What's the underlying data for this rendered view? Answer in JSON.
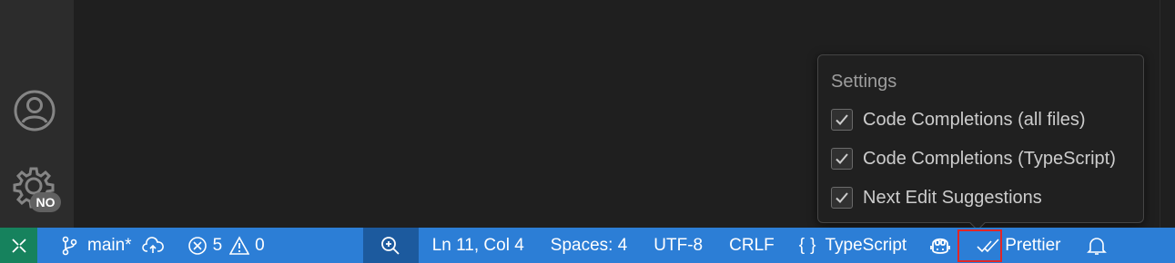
{
  "activity_bar": {
    "icons": [
      "account-icon",
      "manage-gear-icon"
    ],
    "badge": "NO"
  },
  "status_bar": {
    "remote_icon": "remote-icon",
    "branch": "main*",
    "errors": "5",
    "warnings": "0",
    "position": "Ln 11, Col 4",
    "spaces": "Spaces: 4",
    "encoding": "UTF-8",
    "eol": "CRLF",
    "language_braces": "{}",
    "language": "TypeScript",
    "formatter": "Prettier"
  },
  "settings_popup": {
    "title": "Settings",
    "options": [
      {
        "label": "Code Completions (all files)",
        "checked": true
      },
      {
        "label": "Code Completions (TypeScript)",
        "checked": true
      },
      {
        "label": "Next Edit Suggestions",
        "checked": true
      }
    ]
  },
  "colors": {
    "status_bar": "#2c7ed6",
    "remote": "#16825d",
    "zoom": "#1c5a9e",
    "highlight": "#e22626"
  }
}
